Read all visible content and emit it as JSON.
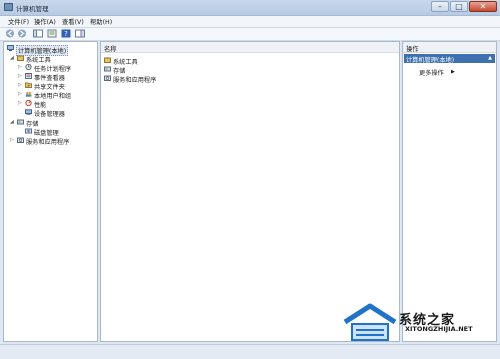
{
  "window": {
    "title": "计算机管理",
    "controls": {
      "minimize": "–",
      "maximize": "□",
      "close": "✕"
    }
  },
  "menu": [
    "文件(F)",
    "操作(A)",
    "查看(V)",
    "帮助(H)"
  ],
  "toolbar": {
    "icons": [
      "back-arrow-icon",
      "forward-arrow-icon",
      "show-hide-tree-icon",
      "properties-icon",
      "help-icon",
      "action-pane-icon"
    ]
  },
  "tree": {
    "root": "计算机管理(本地)",
    "system_tools": "系统工具",
    "system_tools_children": [
      "任务计划程序",
      "事件查看器",
      "共享文件夹",
      "本地用户和组",
      "性能",
      "设备管理器"
    ],
    "storage": "存储",
    "storage_children": [
      "磁盘管理"
    ],
    "services": "服务和应用程序"
  },
  "center": {
    "column_header": "名称",
    "items": [
      "系统工具",
      "存储",
      "服务和应用程序"
    ]
  },
  "actions": {
    "header": "操作",
    "selected": "计算机管理(本地)",
    "more": "更多操作"
  },
  "watermark": {
    "text": "系统之家",
    "url": "XITONGZHIJIA.NET"
  },
  "colors": {
    "selection": "#3e6fb0",
    "pane_border": "#a9b9cb",
    "folder": "#e8c25a"
  }
}
